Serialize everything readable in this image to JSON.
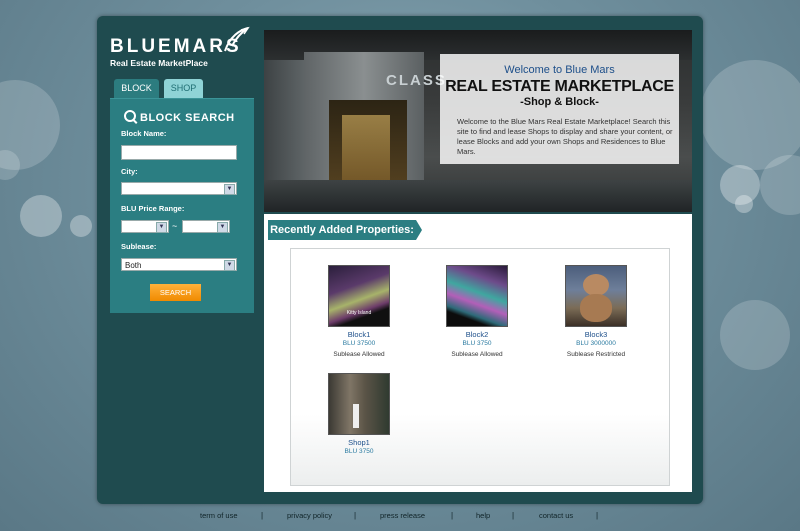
{
  "logo": {
    "name": "BLUEMARS",
    "tagline": "Real Estate MarketPlace"
  },
  "tabs": [
    {
      "label": "BLOCK"
    },
    {
      "label": "SHOP"
    }
  ],
  "search": {
    "title": "BLOCK SEARCH",
    "block_name_label": "Block Name:",
    "block_name_value": "",
    "city_label": "City:",
    "city_value": "",
    "price_label": "BLU Price Range:",
    "price_min_value": "",
    "price_max_value": "",
    "price_separator": "~",
    "sublease_label": "Sublease:",
    "sublease_value": "Both",
    "button_label": "SEARCH"
  },
  "hero": {
    "sign_text": "CLASS",
    "welcome": "Welcome to Blue Mars",
    "title": "REAL ESTATE MARKETPLACE",
    "subtitle": "-Shop & Block-",
    "description": "Welcome to the Blue Mars Real Estate Marketplace! Search this site to find and lease Shops to display and share your content, or lease Blocks and add your own Shops and Residences to Blue Mars."
  },
  "recent": {
    "heading": "Recently Added Properties:",
    "items": [
      {
        "name": "Block1",
        "price": "BLU 37500",
        "sublease": "Sublease Allowed",
        "thumb_caption": "Kitty Island"
      },
      {
        "name": "Block2",
        "price": "BLU 3750",
        "sublease": "Sublease Allowed"
      },
      {
        "name": "Block3",
        "price": "BLU 3000000",
        "sublease": "Sublease Restricted"
      },
      {
        "name": "Shop1",
        "price": "BLU 3750",
        "sublease": ""
      }
    ]
  },
  "footer": {
    "links": [
      "term of use",
      "privacy policy",
      "press release",
      "help",
      "contact us"
    ],
    "separator": "|"
  }
}
